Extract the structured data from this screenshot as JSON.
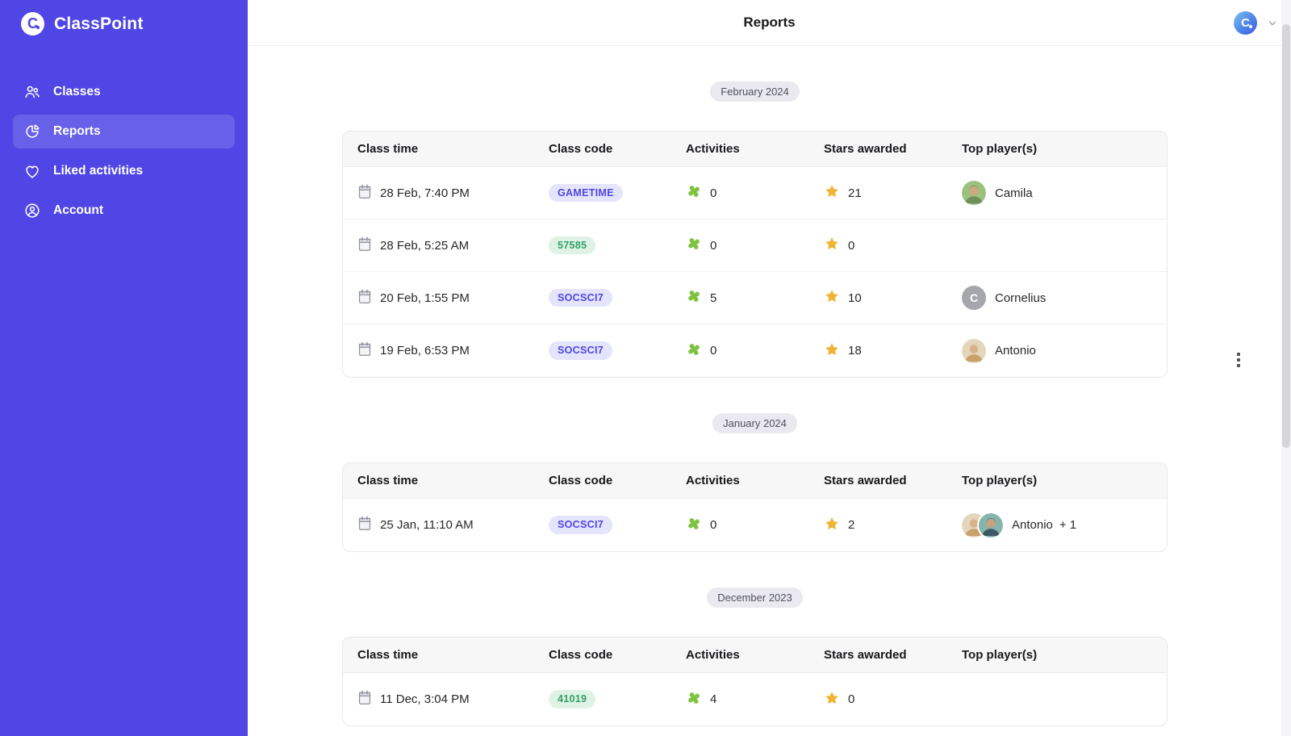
{
  "app": {
    "name": "ClassPoint",
    "logo_glyph": "C"
  },
  "colors": {
    "sidebar": "#4f46e5",
    "star": "#f0b434",
    "puzzle": "#7fc241",
    "badge_indigo_bg": "#e4e4fc",
    "badge_indigo_text": "#4f46e5",
    "badge_green_bg": "#def3e6",
    "badge_green_text": "#34a065",
    "month_badge_bg": "#e9e9ef",
    "month_badge_text": "#52525b"
  },
  "sidebar": {
    "logo_text": "ClassPoint",
    "items": [
      {
        "label": "Classes",
        "icon": "people-icon",
        "active": false
      },
      {
        "label": "Reports",
        "icon": "pie-chart-icon",
        "active": true
      },
      {
        "label": "Liked activities",
        "icon": "heart-icon",
        "active": false
      },
      {
        "label": "Account",
        "icon": "person-circle-icon",
        "active": false
      }
    ]
  },
  "header": {
    "title": "Reports",
    "user_avatar_glyph": "C"
  },
  "table": {
    "columns": [
      "Class time",
      "Class code",
      "Activities",
      "Stars awarded",
      "Top player(s)"
    ]
  },
  "sections": [
    {
      "month_label": "February 2024",
      "rows": [
        {
          "class_time": "28 Feb, 7:40 PM",
          "class_code": "GAMETIME",
          "code_color": "indigo",
          "activities": "0",
          "stars": "21",
          "top_players": {
            "avatars": [
              {
                "style": "photo-green",
                "initial": ""
              }
            ],
            "name": "Camila",
            "extra": ""
          }
        },
        {
          "class_time": "28 Feb, 5:25 AM",
          "class_code": "57585",
          "code_color": "green",
          "activities": "0",
          "stars": "0",
          "top_players": {
            "avatars": [],
            "name": "",
            "extra": ""
          }
        },
        {
          "class_time": "20 Feb, 1:55 PM",
          "class_code": "SOCSCI7",
          "code_color": "indigo",
          "activities": "5",
          "stars": "10",
          "top_players": {
            "avatars": [
              {
                "style": "initial-gray",
                "initial": "C"
              }
            ],
            "name": "Cornelius",
            "extra": ""
          }
        },
        {
          "class_time": "19 Feb, 6:53 PM",
          "class_code": "SOCSCI7",
          "code_color": "indigo",
          "activities": "0",
          "stars": "18",
          "top_players": {
            "avatars": [
              {
                "style": "photo-warm",
                "initial": ""
              }
            ],
            "name": "Antonio",
            "extra": ""
          }
        }
      ]
    },
    {
      "month_label": "January 2024",
      "rows": [
        {
          "class_time": "25 Jan, 11:10 AM",
          "class_code": "SOCSCI7",
          "code_color": "indigo",
          "activities": "0",
          "stars": "2",
          "top_players": {
            "avatars": [
              {
                "style": "photo-warm",
                "initial": ""
              },
              {
                "style": "photo-teal",
                "initial": ""
              }
            ],
            "name": "Antonio",
            "extra": "+ 1"
          }
        }
      ]
    },
    {
      "month_label": "December 2023",
      "rows": [
        {
          "class_time": "11 Dec, 3:04 PM",
          "class_code": "41019",
          "code_color": "green",
          "activities": "4",
          "stars": "0",
          "top_players": {
            "avatars": [],
            "name": "",
            "extra": ""
          }
        }
      ]
    }
  ]
}
